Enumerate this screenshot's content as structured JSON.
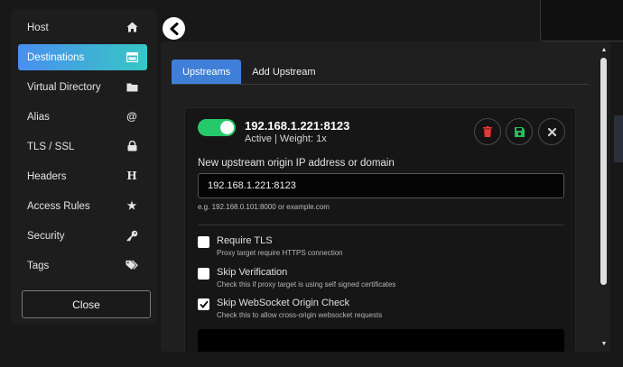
{
  "sidebar": {
    "items": [
      {
        "label": "Host",
        "icon": "home-icon"
      },
      {
        "label": "Destinations",
        "icon": "window-icon",
        "active": true
      },
      {
        "label": "Virtual Directory",
        "icon": "folder-icon"
      },
      {
        "label": "Alias",
        "icon": "at-icon"
      },
      {
        "label": "TLS / SSL",
        "icon": "lock-icon"
      },
      {
        "label": "Headers",
        "icon": "heading-icon"
      },
      {
        "label": "Access Rules",
        "icon": "star-icon"
      },
      {
        "label": "Security",
        "icon": "key-icon"
      },
      {
        "label": "Tags",
        "icon": "tags-icon"
      }
    ],
    "close_label": "Close"
  },
  "tabs": [
    {
      "label": "Upstreams",
      "active": true
    },
    {
      "label": "Add Upstream",
      "active": false
    }
  ],
  "upstream": {
    "address": "192.168.1.221:8123",
    "status": "Active | Weight: 1x",
    "enabled": true,
    "origin_label": "New upstream origin IP address or domain",
    "origin_value": "192.168.1.221:8123",
    "origin_hint": "e.g. 192.168.0.101:8000 or example.com",
    "options": [
      {
        "label": "Require TLS",
        "desc": "Proxy target require HTTPS connection",
        "checked": false
      },
      {
        "label": "Skip Verification",
        "desc": "Check this if proxy target is using self signed certificates",
        "checked": false
      },
      {
        "label": "Skip WebSocket Origin Check",
        "desc": "Check this to allow cross-origin websocket requests",
        "checked": true
      }
    ]
  },
  "colors": {
    "accent_start": "#4a8ff0",
    "accent_end": "#36c7c4",
    "toggle_on": "#26c96a",
    "delete_red": "#e53935",
    "save_green": "#2bbd5a"
  }
}
